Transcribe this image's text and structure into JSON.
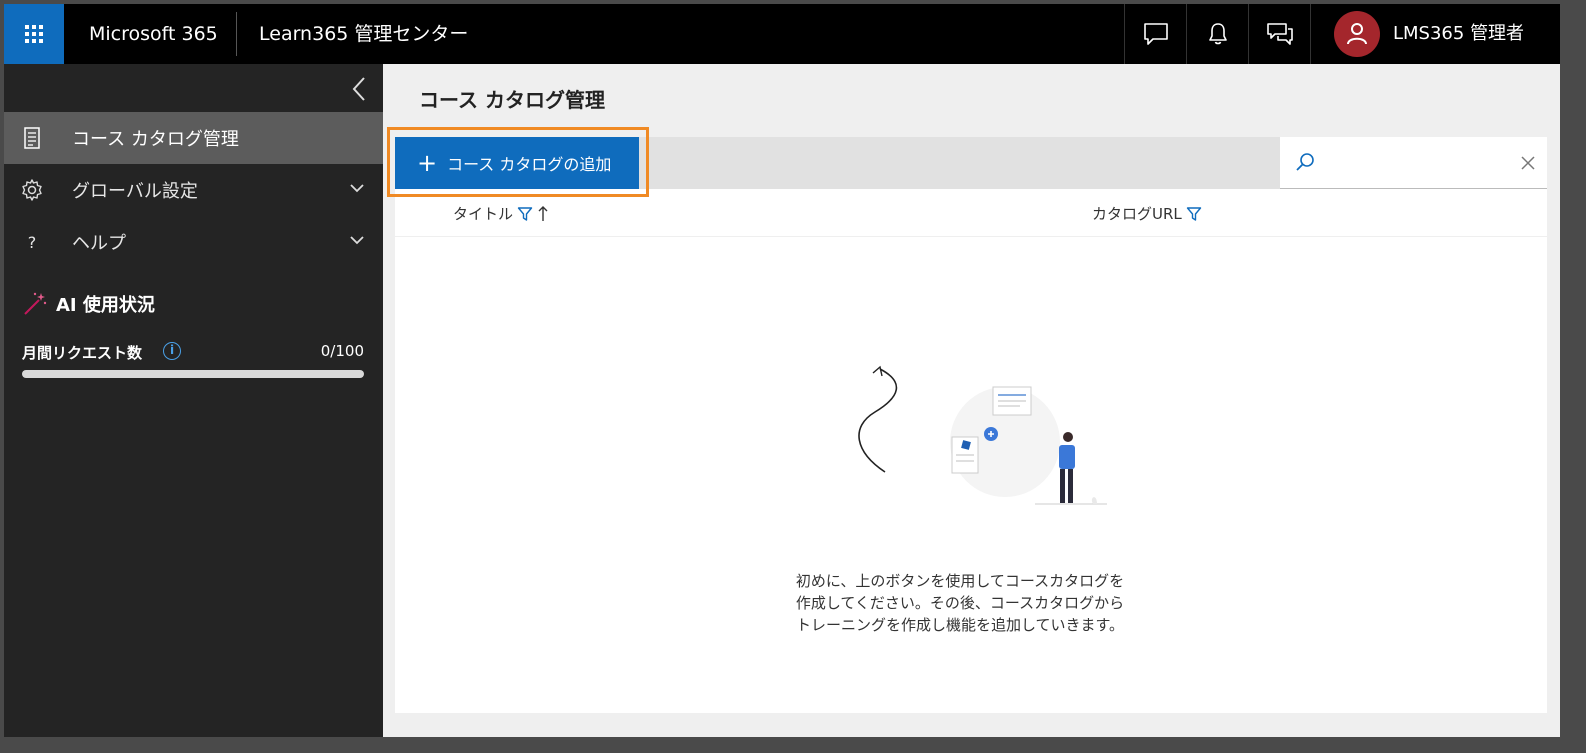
{
  "header": {
    "brand": "Microsoft 365",
    "app_title": "Learn365 管理センター",
    "user_name": "LMS365 管理者",
    "icons": [
      "chat-icon",
      "bell-icon",
      "feedback-icon"
    ]
  },
  "sidebar": {
    "items": [
      {
        "label": "コース カタログ管理",
        "icon": "catalog-icon",
        "active": true
      },
      {
        "label": "グローバル設定",
        "icon": "gear-icon",
        "expandable": true
      },
      {
        "label": "ヘルプ",
        "icon": "help-icon",
        "expandable": true
      }
    ],
    "ai_usage": {
      "heading": "AI 使用状況",
      "label": "月間リクエスト数",
      "value": "0/100",
      "fraction": 0
    }
  },
  "main": {
    "page_title": "コース カタログ管理",
    "add_button_label": "コース カタログの追加",
    "search": {
      "value": ""
    },
    "columns": [
      {
        "label": "タイトル",
        "sort": "ascending",
        "filter": true
      },
      {
        "label": "カタログURL",
        "filter": true
      }
    ],
    "empty_message": "初めに、上のボタンを使用してコースカタログを作成してください。その後、コースカタログからトレーニングを作成し機能を追加していきます。"
  },
  "colors": {
    "accent": "#0f6cbd",
    "highlight": "#f08a24",
    "avatar": "#a4262c",
    "sidebar_bg": "#242424"
  }
}
